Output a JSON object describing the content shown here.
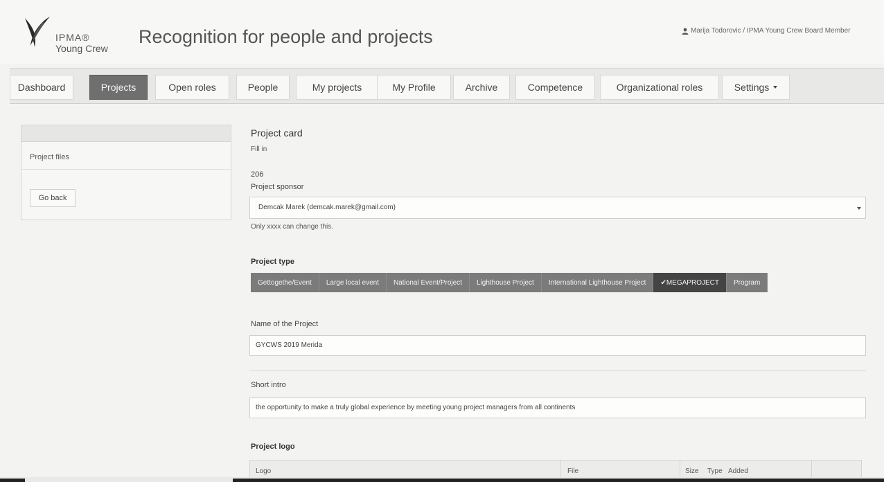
{
  "header": {
    "brand_line1": "IPMA®",
    "brand_line2": "Young Crew",
    "app_title": "Recognition for people and projects",
    "user": "Marija Todorovic / IPMA Young Crew Board Member",
    "user_icon": "user-icon"
  },
  "nav": {
    "items": [
      {
        "label": "Dashboard"
      },
      {
        "label": "Projects"
      },
      {
        "label": "Open roles"
      },
      {
        "label": "People"
      },
      {
        "label": "My projects"
      },
      {
        "label": "My Profile"
      },
      {
        "label": "Archive"
      },
      {
        "label": "Competence"
      },
      {
        "label": "Organizational roles"
      },
      {
        "label": "Settings"
      }
    ],
    "active": "Projects"
  },
  "sidebar": {
    "files_label": "Project files",
    "go_back": "Go back"
  },
  "main": {
    "card_title": "Project card",
    "fill_in": "Fill in",
    "project_number": "206",
    "sponsor_label": "Project sponsor",
    "sponsor_value": "Demcak Marek (demcak.marek@gmail.com)",
    "sponsor_hint": "Only xxxx can change this.",
    "type_label": "Project type",
    "types": [
      {
        "label": "Gettogethe/Event"
      },
      {
        "label": "Large local event"
      },
      {
        "label": "National Event/Project"
      },
      {
        "label": "Lighthouse Project"
      },
      {
        "label": "International Lighthouse Project"
      },
      {
        "label": "✔MEGAPROJECT"
      },
      {
        "label": "Program"
      }
    ],
    "selected_type": "MEGAPROJECT",
    "name_label": "Name of the Project",
    "name_value": "GYCWS 2019 Merida",
    "intro_label": "Short intro",
    "intro_value": "the opportunity to make a truly global experience by meeting young project managers from all continents",
    "logo_label": "Project logo",
    "logo_table_headers": {
      "logo": "Logo",
      "file": "File",
      "size": "Size",
      "type": "Type",
      "added": "Added"
    }
  },
  "colors": {
    "active_nav": "#6f6f6f",
    "type_button": "#7b7b7b",
    "type_selected": "#444444"
  }
}
